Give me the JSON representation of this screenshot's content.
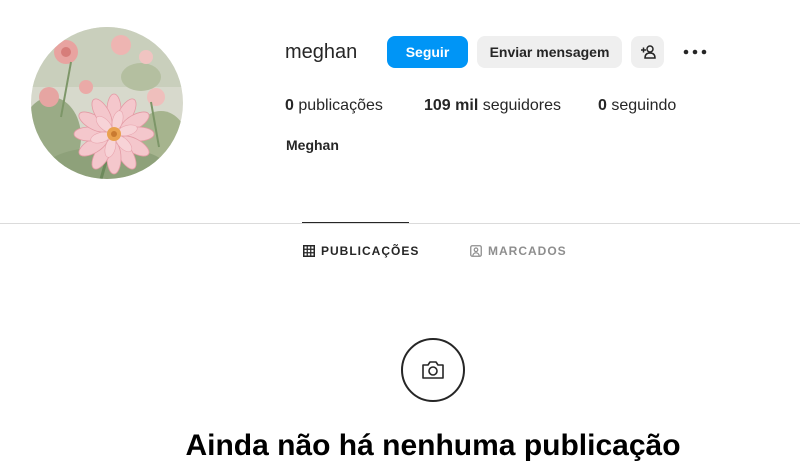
{
  "profile": {
    "username": "meghan",
    "full_name": "Meghan",
    "avatar_icon": "flower-photo-avatar"
  },
  "actions": {
    "follow_label": "Seguir",
    "message_label": "Enviar mensagem",
    "suggest_icon": "person-add-icon",
    "more_icon": "more-options-icon"
  },
  "stats": {
    "posts_count": "0",
    "posts_label": "publicações",
    "followers_count": "109 mil",
    "followers_label": "seguidores",
    "following_count": "0",
    "following_label": "seguindo"
  },
  "tabs": [
    {
      "label": "PUBLICAÇÕES",
      "icon": "grid-icon",
      "active": true
    },
    {
      "label": "MARCADOS",
      "icon": "tagged-person-icon",
      "active": false
    }
  ],
  "empty_state": {
    "icon": "camera-icon",
    "title": "Ainda não há nenhuma publicação"
  },
  "colors": {
    "accent": "#0095f6",
    "button_secondary": "#efefef",
    "text_primary": "#262626",
    "text_secondary": "#8e8e8e",
    "divider": "#dbdbdb"
  }
}
